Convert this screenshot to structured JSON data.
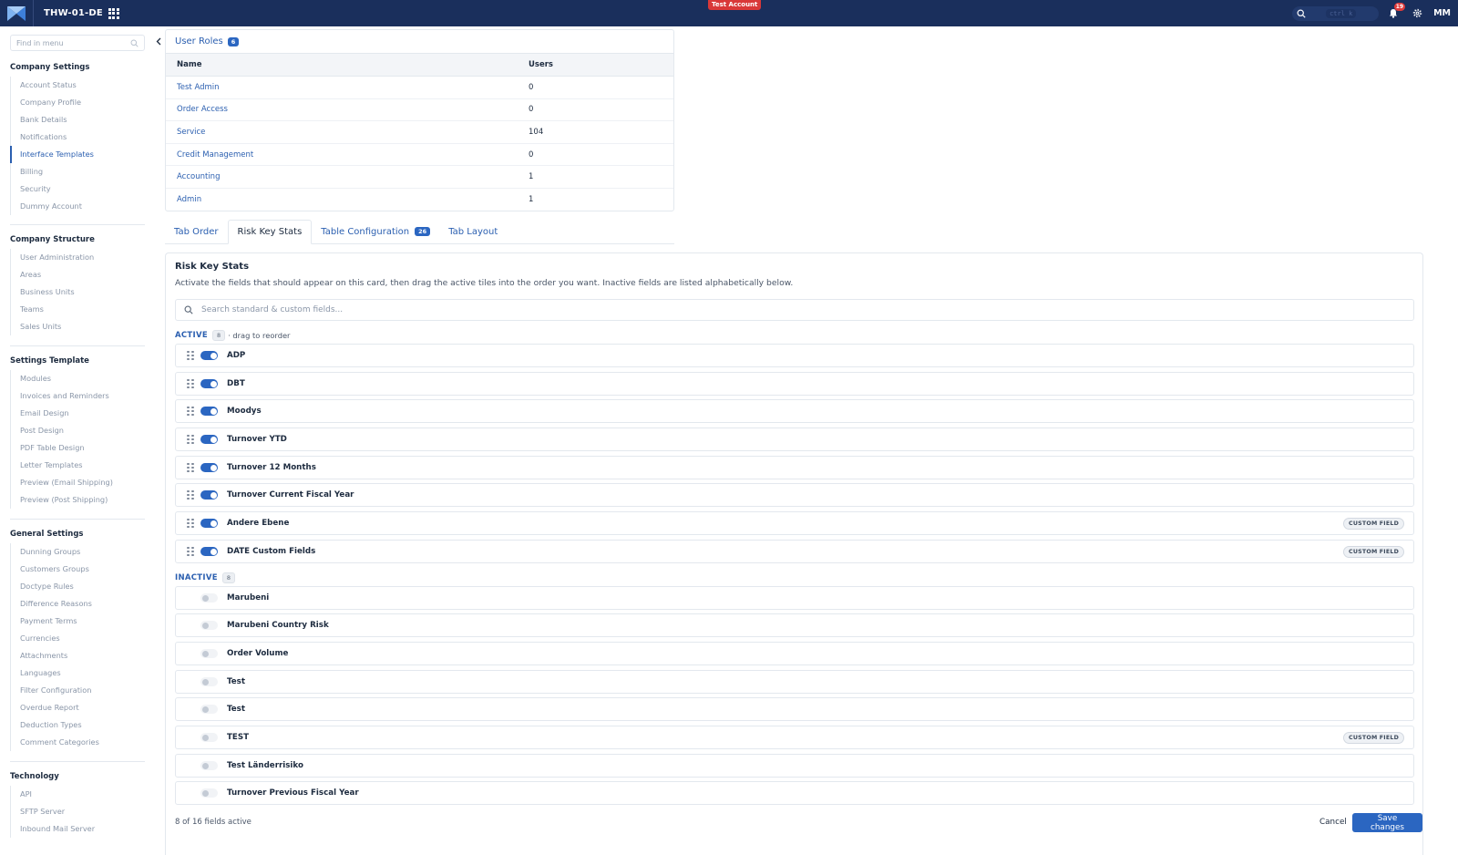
{
  "topbar": {
    "account_name": "THW-01-DE",
    "test_badge": "Test Account",
    "search_shortcut": "ctrl k",
    "notification_count": "19",
    "avatar_initials": "MM"
  },
  "sidebar": {
    "search_placeholder": "Find in menu",
    "sections": [
      {
        "heading": "Company Settings",
        "items": [
          "Account Status",
          "Company Profile",
          "Bank Details",
          "Notifications",
          "Interface Templates",
          "Billing",
          "Security",
          "Dummy Account"
        ],
        "active_index": 4
      },
      {
        "heading": "Company Structure",
        "items": [
          "User Administration",
          "Areas",
          "Business Units",
          "Teams",
          "Sales Units"
        ]
      },
      {
        "heading": "Settings Template",
        "items": [
          "Modules",
          "Invoices and Reminders",
          "Email Design",
          "Post Design",
          "PDF Table Design",
          "Letter Templates",
          "Preview (Email Shipping)",
          "Preview (Post Shipping)"
        ]
      },
      {
        "heading": "General Settings",
        "items": [
          "Dunning Groups",
          "Customers Groups",
          "Doctype Rules",
          "Difference Reasons",
          "Payment Terms",
          "Currencies",
          "Attachments",
          "Languages",
          "Filter Configuration",
          "Overdue Report",
          "Deduction Types",
          "Comment Categories"
        ]
      },
      {
        "heading": "Technology",
        "items": [
          "API",
          "SFTP Server",
          "Inbound Mail Server"
        ]
      }
    ]
  },
  "user_roles": {
    "title": "User Roles",
    "count": "6",
    "columns": [
      "Name",
      "Users"
    ],
    "rows": [
      {
        "name": "Test Admin",
        "users": "0"
      },
      {
        "name": "Order Access",
        "users": "0"
      },
      {
        "name": "Service",
        "users": "104"
      },
      {
        "name": "Credit Management",
        "users": "0"
      },
      {
        "name": "Accounting",
        "users": "1"
      },
      {
        "name": "Admin",
        "users": "1"
      }
    ]
  },
  "tabs": {
    "tab_order": "Tab Order",
    "risk_key_stats": "Risk Key Stats",
    "table_configuration": "Table Configuration",
    "table_configuration_count": "26",
    "tab_layout": "Tab Layout"
  },
  "risk_key_stats": {
    "title": "Risk Key Stats",
    "description": "Activate the fields that should appear on this card, then drag the active tiles into the order you want. Inactive fields are listed alphabetically below.",
    "search_placeholder": "Search standard & custom fields...",
    "active_label": "ACTIVE",
    "active_count": "8",
    "active_hint": "· drag to reorder",
    "inactive_label": "INACTIVE",
    "inactive_count": "8",
    "custom_field_badge": "CUSTOM FIELD",
    "active_fields": [
      {
        "label": "ADP",
        "custom": false
      },
      {
        "label": "DBT",
        "custom": false
      },
      {
        "label": "Moodys",
        "custom": false
      },
      {
        "label": "Turnover YTD",
        "custom": false
      },
      {
        "label": "Turnover 12 Months",
        "custom": false
      },
      {
        "label": "Turnover Current Fiscal Year",
        "custom": false
      },
      {
        "label": "Andere Ebene",
        "custom": true
      },
      {
        "label": "DATE Custom Fields",
        "custom": true
      }
    ],
    "inactive_fields": [
      {
        "label": "Marubeni",
        "custom": false
      },
      {
        "label": "Marubeni Country Risk",
        "custom": false
      },
      {
        "label": "Order Volume",
        "custom": false
      },
      {
        "label": "Test",
        "custom": false
      },
      {
        "label": "Test",
        "custom": false
      },
      {
        "label": "TEST",
        "custom": true
      },
      {
        "label": "Test Länderrisiko",
        "custom": false
      },
      {
        "label": "Turnover Previous Fiscal Year",
        "custom": false
      }
    ],
    "footer_status": "8 of 16 fields active",
    "cancel_label": "Cancel",
    "save_label": "Save changes"
  },
  "colors": {
    "topbar": "#1a2f5c",
    "accent": "#2b66c1",
    "link": "#2b5fb0",
    "test_badge": "#d93838"
  }
}
